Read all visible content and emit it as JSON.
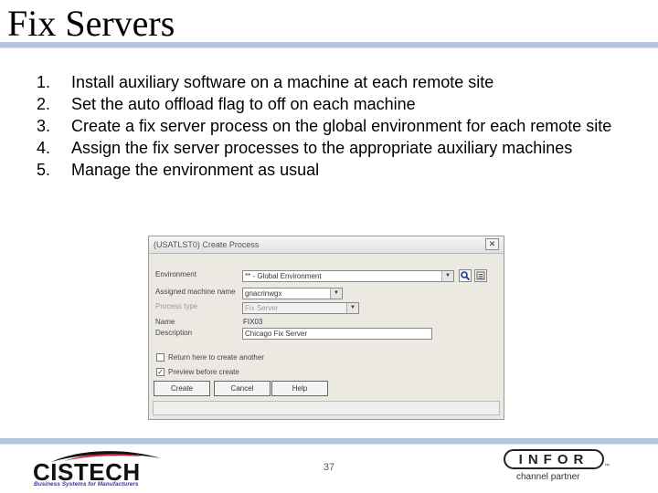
{
  "slide": {
    "title": "Fix Servers",
    "steps": [
      {
        "num": "1.",
        "text": "Install auxiliary software on a machine at each remote site"
      },
      {
        "num": "2.",
        "text": "Set the auto offload flag to off on each machine"
      },
      {
        "num": "3.",
        "text": "Create a fix server process on the global environment for each remote site"
      },
      {
        "num": "4.",
        "text": "Assign the fix server processes to the appropriate auxiliary machines"
      },
      {
        "num": "5.",
        "text": "Manage the environment as usual"
      }
    ],
    "page_number": "37"
  },
  "dialog": {
    "title": "(USATLST0) Create Process",
    "close_glyph": "✕",
    "fields": {
      "environment_label": "Environment",
      "environment_value": "** - Global Environment",
      "machine_label": "Assigned machine name",
      "machine_value": "gnacrinwgx",
      "process_type_label": "Process type",
      "process_type_value": "Fix Server",
      "name_label": "Name",
      "name_value": "FIX03",
      "description_label": "Description",
      "description_value": "Chicago Fix Server"
    },
    "options": {
      "return_label": "Return here to create another",
      "return_checked": false,
      "preview_label": "Preview before create",
      "preview_checked": true
    },
    "buttons": {
      "create": "Create",
      "cancel": "Cancel",
      "help": "Help"
    },
    "icons": [
      "search-icon",
      "list-icon"
    ]
  },
  "logos": {
    "cistech_word": "CISTECH",
    "cistech_tagline": "Business Systems for Manufacturers",
    "infor_word": "INFOR",
    "infor_tagline": "channel partner",
    "infor_mark": "™"
  },
  "colors": {
    "rule": "#b4c4de",
    "dialog_bg": "#ece9e2",
    "infor_red": "#c8202c"
  }
}
